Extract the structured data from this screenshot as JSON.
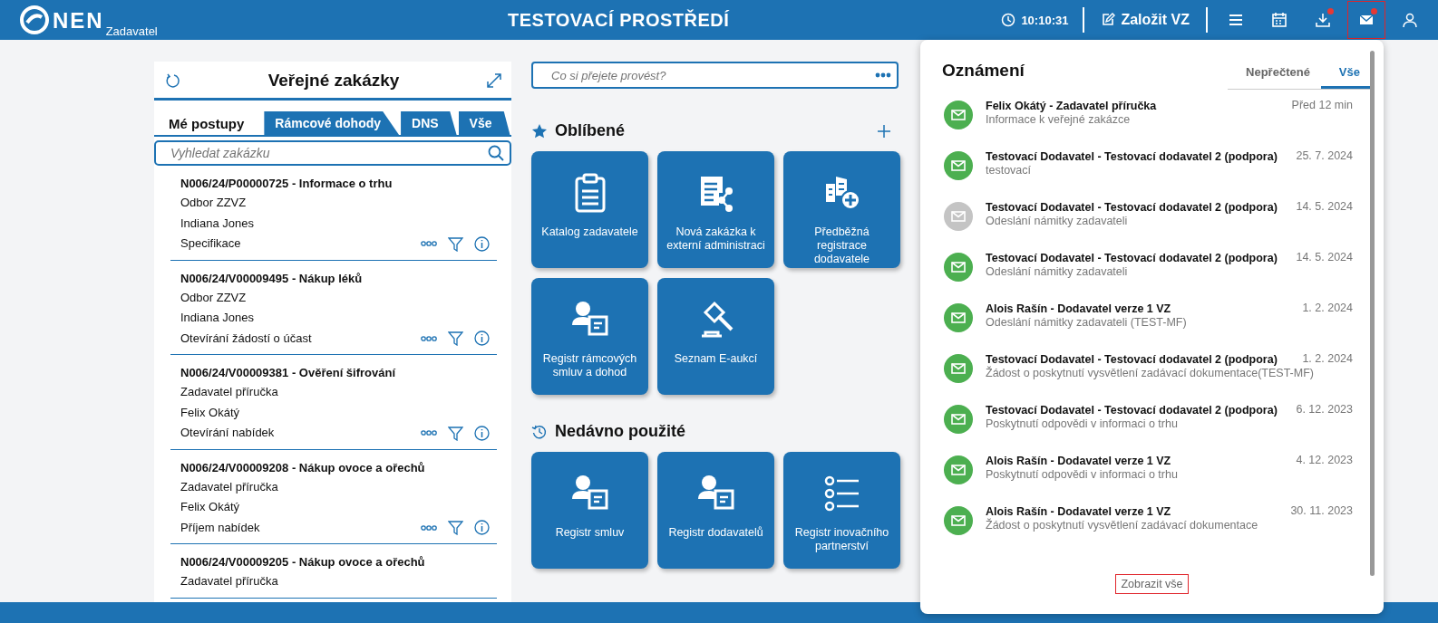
{
  "header": {
    "logo": "NEN",
    "logo_sub": "Zadavatel",
    "title": "TESTOVACÍ PROSTŘEDÍ",
    "time": "10:10:31",
    "create_button": "Založit VZ",
    "icons": [
      {
        "kind": "menu",
        "dot": false,
        "highlighted": false
      },
      {
        "kind": "calendar",
        "dot": false,
        "highlighted": false
      },
      {
        "kind": "download",
        "dot": true,
        "highlighted": false
      },
      {
        "kind": "mail",
        "dot": true,
        "highlighted": true
      },
      {
        "kind": "user",
        "dot": false,
        "highlighted": false
      }
    ]
  },
  "contracts": {
    "title": "Veřejné zakázky",
    "tabs": [
      {
        "label": "Mé postupy",
        "selected": true
      },
      {
        "label": "Rámcové dohody",
        "selected": false
      },
      {
        "label": "DNS",
        "selected": false
      },
      {
        "label": "Vše",
        "selected": false
      }
    ],
    "search": {
      "placeholder": "Vyhledat zakázku"
    },
    "items": [
      {
        "title": "N006/24/P00000725 - Informace o trhu",
        "lines": [
          "Odbor ZZVZ",
          "Indiana Jones",
          "Specifikace"
        ]
      },
      {
        "title": "N006/24/V00009495 - Nákup léků",
        "lines": [
          "Odbor ZZVZ",
          "Indiana Jones",
          "Otevírání žádostí o účast"
        ]
      },
      {
        "title": "N006/24/V00009381 - Ověření šifrování",
        "lines": [
          "Zadavatel příručka",
          "Felix Okátý",
          "Otevírání nabídek"
        ]
      },
      {
        "title": "N006/24/V00009208 - Nákup ovoce a ořechů",
        "lines": [
          "Zadavatel příručka",
          "Felix Okátý",
          "Příjem nabídek"
        ]
      },
      {
        "title": "N006/24/V00009205 - Nákup ovoce a ořechů",
        "lines": [
          "Zadavatel příručka"
        ]
      }
    ]
  },
  "command": {
    "placeholder": "Co si přejete provést?"
  },
  "favorites": {
    "title": "Oblíbené",
    "tiles": [
      {
        "kind": "clipboard",
        "label": "Katalog zadavatele"
      },
      {
        "kind": "share",
        "label": "Nová zakázka k externí administraci"
      },
      {
        "kind": "building",
        "label": "Předběžná registrace dodavatele"
      },
      {
        "kind": "person",
        "label": "Registr rámcových smluv a dohod"
      },
      {
        "kind": "gavel",
        "label": "Seznam E-aukcí"
      }
    ]
  },
  "recent": {
    "title": "Nedávno použité",
    "tiles": [
      {
        "kind": "person",
        "label": "Registr smluv"
      },
      {
        "kind": "person",
        "label": "Registr dodavatelů"
      },
      {
        "kind": "list",
        "label": "Registr inovačního partnerství"
      }
    ]
  },
  "notifications": {
    "title": "Oznámení",
    "tabs": [
      {
        "label": "Nepřečtené",
        "selected": false
      },
      {
        "label": "Vše",
        "selected": true
      }
    ],
    "items": [
      {
        "sender": "Felix Okátý - Zadavatel příručka",
        "subject": "Informace k veřejné zakázce",
        "date": "Před 12 min",
        "unread": true
      },
      {
        "sender": "Testovací Dodavatel - Testovací dodavatel 2 (podpora)",
        "subject": "testovací",
        "date": "25. 7. 2024",
        "unread": true
      },
      {
        "sender": "Testovací Dodavatel - Testovací dodavatel 2 (podpora)",
        "subject": "Odeslání námitky zadavateli",
        "date": "14. 5. 2024",
        "unread": false
      },
      {
        "sender": "Testovací Dodavatel - Testovací dodavatel 2 (podpora)",
        "subject": "Odeslání námitky zadavateli",
        "date": "14. 5. 2024",
        "unread": true
      },
      {
        "sender": "Alois Rašín - Dodavatel verze 1 VZ",
        "subject": "Odeslání námitky zadavateli (TEST-MF)",
        "date": "1. 2. 2024",
        "unread": true
      },
      {
        "sender": "Testovací Dodavatel - Testovací dodavatel 2 (podpora)",
        "subject": "Žádost o poskytnutí vysvětlení zadávací dokumentace(TEST-MF)",
        "date": "1. 2. 2024",
        "unread": true
      },
      {
        "sender": "Testovací Dodavatel - Testovací dodavatel 2 (podpora)",
        "subject": "Poskytnutí odpovědi v informaci o trhu",
        "date": "6. 12. 2023",
        "unread": true
      },
      {
        "sender": "Alois Rašín - Dodavatel verze 1 VZ",
        "subject": "Poskytnutí odpovědi v informaci o trhu",
        "date": "4. 12. 2023",
        "unread": true
      },
      {
        "sender": "Alois Rašín - Dodavatel verze 1 VZ",
        "subject": "Žádost o poskytnutí vysvětlení zadávací dokumentace",
        "date": "30. 11. 2023",
        "unread": true
      }
    ],
    "show_all": {
      "label": "Zobrazit vše",
      "highlighted": true
    }
  }
}
